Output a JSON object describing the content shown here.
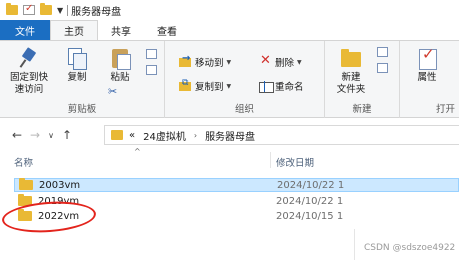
{
  "window": {
    "title": "服务器母盘"
  },
  "ribbon_tabs": [
    "文件",
    "主页",
    "共享",
    "查看"
  ],
  "clipboard": {
    "pin_label_1": "固定到快",
    "pin_label_2": "速访问",
    "copy_label": "复制",
    "paste_label": "粘贴",
    "group_label": "剪贴板"
  },
  "organize": {
    "move_to": "移动到",
    "copy_to": "复制到",
    "delete": "删除",
    "rename": "重命名",
    "group_label": "组织"
  },
  "new": {
    "new_folder_1": "新建",
    "new_folder_2": "文件夹",
    "group_label": "新建"
  },
  "open": {
    "properties": "属性",
    "group_label": "打开"
  },
  "address": {
    "overflow": "«",
    "segments": [
      "24虚拟机",
      "服务器母盘"
    ],
    "separator": "›"
  },
  "columns": {
    "name": "名称",
    "date": "修改日期"
  },
  "files": [
    {
      "name": "2003vm",
      "date": "2024/10/22 1",
      "selected": true
    },
    {
      "name": "2019vm",
      "date": "2024/10/22 1",
      "selected": false
    },
    {
      "name": "2022vm",
      "date": "2024/10/15 1",
      "selected": false
    }
  ],
  "watermark": "CSDN @sdszoe4922",
  "colors": {
    "file_tab": "#1b6ec2",
    "folder": "#e9b935",
    "selection": "#cce8ff",
    "annotation": "#e3241c"
  }
}
